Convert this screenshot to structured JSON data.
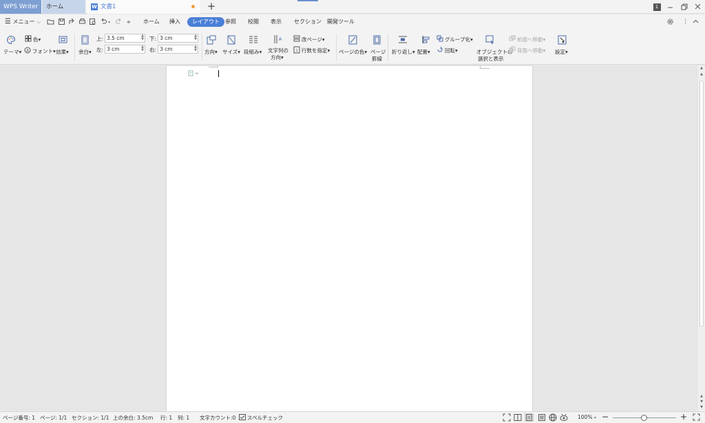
{
  "titlebar": {
    "app_tab": "WPS Writer",
    "home_tab": "ホーム",
    "doc_icon": "W",
    "doc_tab": "文書1",
    "new_tab": "+",
    "badge": "1"
  },
  "menubar": {
    "menu_label": "メニュー",
    "tabs": [
      "ホーム",
      "挿入",
      "レイアウト",
      "参照",
      "校閲",
      "表示",
      "セクション",
      "開発ツール"
    ],
    "active_tab": "レイアウト"
  },
  "ribbon": {
    "theme": "テーマ",
    "color": "色",
    "font": "フォント",
    "effect": "効果",
    "margin": "余白",
    "top_label": "上:",
    "top_value": "3.5 cm",
    "left_label": "左:",
    "left_value": "3 cm",
    "bottom_label": "下:",
    "bottom_value": "3 cm",
    "right_label": "右:",
    "right_value": "3 cm",
    "orientation": "方向",
    "size": "サイズ",
    "columns": "段組み",
    "text_direction_1": "文字列の",
    "text_direction_2": "方向",
    "page_break": "改ページ",
    "line_numbers": "行数を指定",
    "page_color": "ページの色",
    "page_border_1": "ページ",
    "page_border_2": "罫線",
    "wrap": "折り返し",
    "align": "配置",
    "group": "グループ化",
    "rotate": "回転",
    "select_pane_1": "オブジェクトの",
    "select_pane_2": "選択と表示",
    "bring_forward": "前面へ移動",
    "send_backward": "背面へ移動",
    "settings": "設定"
  },
  "statusbar": {
    "page_number": "ページ番号: 1",
    "pages": "ページ: 1/1",
    "section": "セクション: 1/1",
    "top_margin": "上の余白: 3.5cm",
    "line": "行: 1",
    "column": "列: 1",
    "word_count": "文字カウント:0",
    "spell_check": "スペルチェック",
    "zoom": "100%",
    "zoom_fraction": 0.5
  },
  "colors": {
    "accent": "#4a7fd6",
    "app_tab": "#7d9fd2",
    "modified_dot": "#f39c3c"
  }
}
